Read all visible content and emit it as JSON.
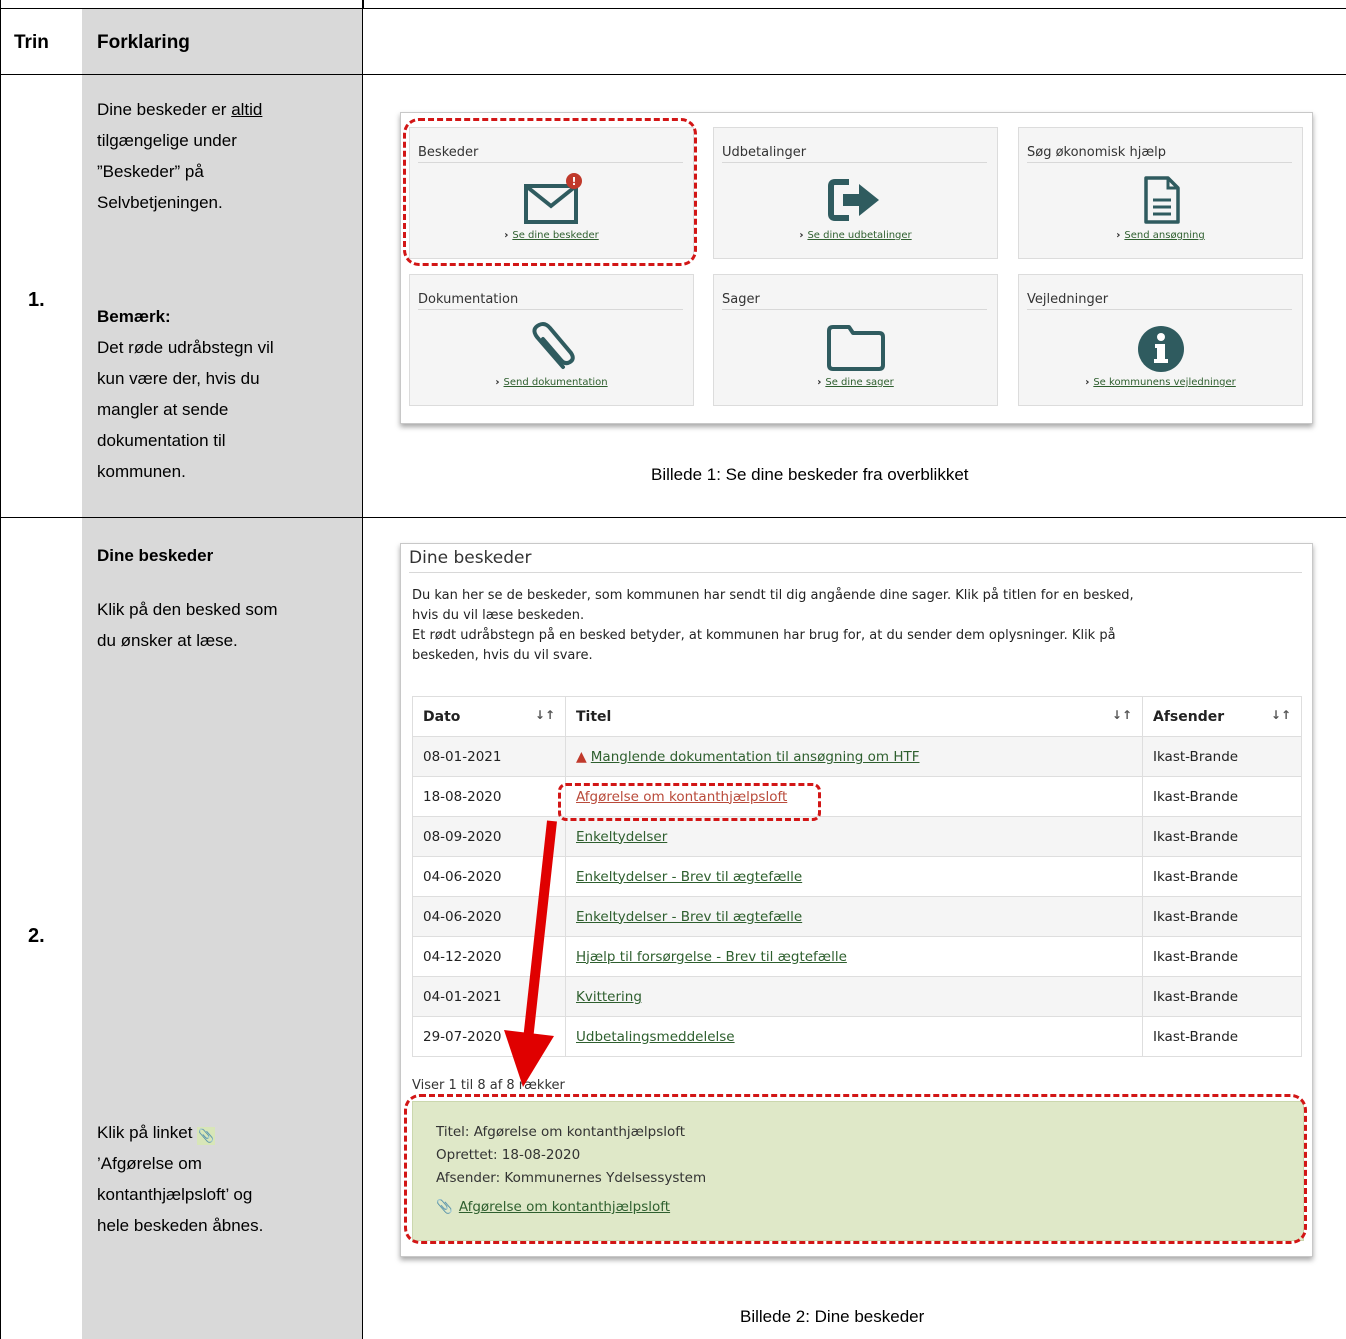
{
  "header": {
    "col1": "Trin",
    "col2": "Forklaring"
  },
  "step1": {
    "number": "1.",
    "text_lines": [
      "Dine beskeder er ",
      "tilgængelige under",
      "”Beskeder” på",
      "Selvbetjeningen."
    ],
    "text_underlined": "altid",
    "note_title": "Bemærk:",
    "note_lines": [
      "Det røde udråbstegn vil",
      "kun være der, hvis du",
      "mangler at sende",
      "dokumentation til",
      "kommunen."
    ],
    "caption": "Billede 1: Se dine beskeder fra overblikket"
  },
  "overview": {
    "tiles": [
      {
        "title": "Beskeder",
        "icon": "envelope-icon",
        "link": "Se dine beskeder"
      },
      {
        "title": "Udbetalinger",
        "icon": "sign-out-arrow-icon",
        "link": "Se dine udbetalinger"
      },
      {
        "title": "Søg økonomisk hjælp",
        "icon": "document-icon",
        "link": "Send ansøgning"
      },
      {
        "title": "Dokumentation",
        "icon": "paperclip-icon",
        "link": "Send dokumentation"
      },
      {
        "title": "Sager",
        "icon": "folder-icon",
        "link": "Se dine sager"
      },
      {
        "title": "Vejledninger",
        "icon": "info-icon",
        "link": "Se kommunens vejledninger"
      }
    ],
    "badge": "!"
  },
  "step2": {
    "number": "2.",
    "heading": "Dine beskeder",
    "text_lines": [
      "Klik på den besked som",
      "du ønsker at læse."
    ],
    "text2_lines": [
      "Klik på linket ",
      "’Afgørelse om",
      "kontanthjælpsloft’ og",
      "hele beskeden åbnes."
    ],
    "caption": "Billede 2: Dine beskeder"
  },
  "messages": {
    "title": "Dine beskeder",
    "intro_lines": [
      "Du kan her se de beskeder, som kommunen har sendt til dig angående dine sager. Klik på titlen for en besked,",
      "hvis du vil læse beskeden.",
      "Et rødt udråbstegn på en besked betyder, at kommunen har brug for, at du sender dem oplysninger. Klik på",
      "beskeden, hvis du vil svare."
    ],
    "columns": [
      "Dato",
      "Titel",
      "Afsender"
    ],
    "sort_icons": [
      "↓↑",
      "↓↑",
      "↓↑"
    ],
    "rows": [
      {
        "date": "08-01-2021",
        "title": "Manglende dokumentation til ansøgning om HTF",
        "sender": "Ikast-Brande",
        "warning": true
      },
      {
        "date": "18-08-2020",
        "title": "Afgørelse om kontanthjælpsloft",
        "sender": "Ikast-Brande"
      },
      {
        "date": "08-09-2020",
        "title": "Enkeltydelser",
        "sender": "Ikast-Brande"
      },
      {
        "date": "04-06-2020",
        "title": "Enkeltydelser - Brev til ægtefælle",
        "sender": "Ikast-Brande"
      },
      {
        "date": "04-06-2020",
        "title": "Enkeltydelser - Brev til ægtefælle",
        "sender": "Ikast-Brande"
      },
      {
        "date": "04-12-2020",
        "title": "Hjælp til forsørgelse - Brev til ægtefælle",
        "sender": "Ikast-Brande"
      },
      {
        "date": "04-01-2021",
        "title": "Kvittering",
        "sender": "Ikast-Brande"
      },
      {
        "date": "29-07-2020",
        "title": "Udbetalingsmeddelelse",
        "sender": "Ikast-Brande"
      }
    ],
    "count_text": "Viser 1 til 8 af 8 rækker",
    "detail": {
      "title_line": "Titel: Afgørelse om kontanthjælpsloft",
      "created_line": "Oprettet: 18-08-2020",
      "sender_line": "Afsender: Kommunernes Ydelsessystem",
      "attachment": "Afgørelse om kontanthjælpsloft"
    }
  },
  "colors": {
    "accent_green": "#2e5f2e",
    "icon_teal": "#2f5b5f",
    "annotation_red": "#d21616",
    "panel_grey": "#d9d9d9"
  }
}
